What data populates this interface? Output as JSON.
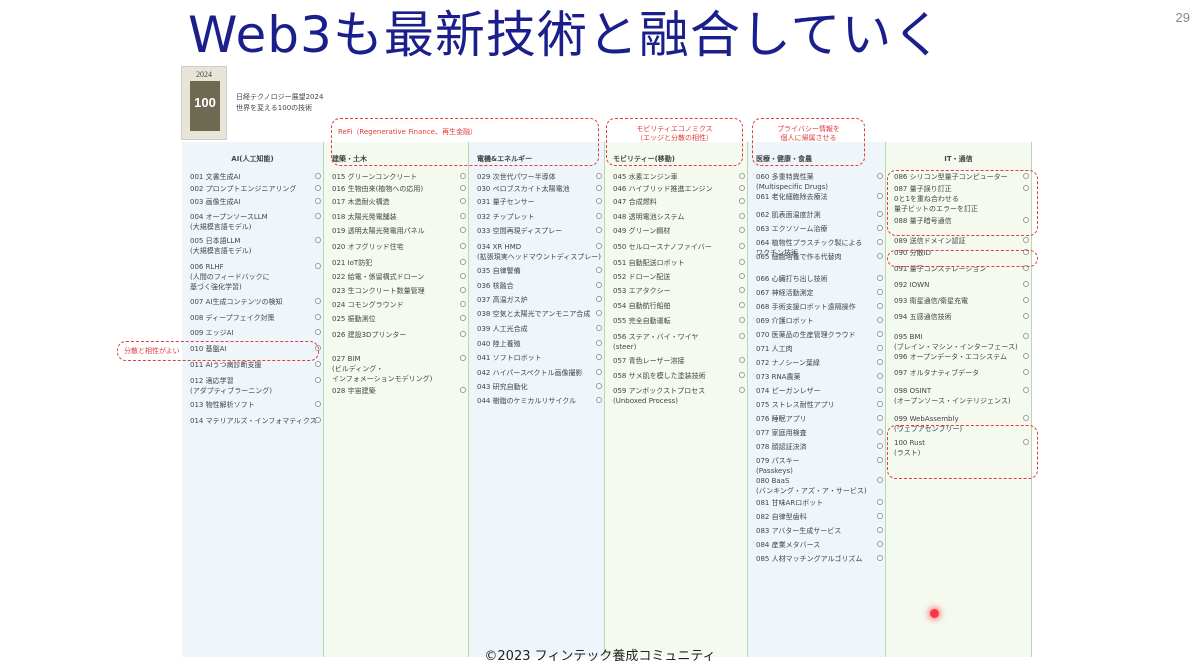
{
  "slide": {
    "title": "Web3も最新技術と融合していく",
    "page_number": "29",
    "footer": "©2023 フィンテック養成コミュニティ"
  },
  "book": {
    "cover_year": "2024",
    "cover_number": "100",
    "title_line1": "日経テクノロジー展望2024",
    "title_line2": "世界を変える100の技術"
  },
  "columns": [
    {
      "header": "AI(人工知能)",
      "items": [
        "001 文書生成AI",
        "002 プロンプトエンジニアリング",
        "003 画像生成AI",
        "004 オープンソースLLM\n(大規模言語モデル)",
        "005 日本語LLM\n(大規模言語モデル)",
        "006 RLHF\n(人間のフィードバックに\n基づく強化学習)",
        "007 AI生成コンテンツの検知",
        "008 ディープフェイク対策",
        "009 エッジAI",
        "010 基盤AI",
        "011 AIうつ病診断支援",
        "012 適応学習\n(アダプティブラーニング)",
        "013 物性解析ソフト",
        "014 マテリアルズ・インフォマティクス"
      ]
    },
    {
      "header": "建築・土木",
      "items": [
        "015 グリーンコンクリート",
        "016 生物由来(植物への応用)",
        "017 木造耐火構造",
        "018 太陽光発電舗装",
        "019 透明太陽光発電用パネル",
        "020 オフグリッド住宅",
        "021 IoT防犯",
        "022 給電・係留構式ドローン",
        "023 生コンクリート数量管理",
        "024 コモングラウンド",
        "025 振動測位",
        "026 建設3Dプリンター",
        "027 BIM\n(ビルディング・\nインフォメーションモデリング)",
        "028 宇宙建築"
      ]
    },
    {
      "header": "電機&エネルギー",
      "items": [
        "029 次世代パワー半導体",
        "030 ペロブスカイト太陽電池",
        "031 量子センサー",
        "032 チップレット",
        "033 空間再現ディスプレー",
        "034 XR HMD\n(拡張現実ヘッドマウントディスプレー)",
        "035 自律警備",
        "036 核融合",
        "037 高温ガス炉",
        "038 空気と太陽光でアンモニア合成",
        "039 人工光合成",
        "040 陸上養殖",
        "041 ソフトロボット",
        "042 ハイパースペクトル画像撮影",
        "043 研究自動化",
        "044 樹脂のケミカルリサイクル"
      ]
    },
    {
      "header": "モビリティー(移動)",
      "items": [
        "045 水素エンジン車",
        "046 ハイブリッド推進エンジン",
        "047 合成燃料",
        "048 透明電池システム",
        "049 グリーン鋼材",
        "050 セルロースナノファイバー",
        "051 自動配送ロボット",
        "052 ドローン配送",
        "053 エアタクシー",
        "054 自動航行船舶",
        "055 完全自動運転",
        "056 ステア・バイ・ワイヤ\n(steer)",
        "057 青色レーザー溶接",
        "058 サメ肌を模した塗装技術",
        "059 アンボックストプロセス\n(Unboxed Process)"
      ]
    },
    {
      "header": "医療・健康・食農",
      "items": [
        "060 多重特異性薬\n(Multispecific Drugs)",
        "061 老化細胞除去療法",
        "062 肌表面温度計測",
        "063 エクソソーム治療",
        "064 植物性プラスチック製による\nワクチン技術",
        "065 細胞培養で作る代替肉",
        "066 心臓打ち出し技術",
        "067 神経活動測定",
        "068 手術支援ロボット遠隔操作",
        "069 介護ロボット",
        "070 医薬品の生産管理クラウド",
        "071 人工肉",
        "072 ナノシーン葉緑",
        "073 RNA農薬",
        "074 ピーガンレザー",
        "075 ストレス耐性アプリ",
        "076 睡眠アプリ",
        "077 家庭用検査",
        "078 顔認証決済",
        "079 パスキー\n(Passkeys)",
        "080 BaaS\n(バンキング・アズ・ア・サービス)",
        "081 甘味ARロボット",
        "082 自律型歯科",
        "083 アバター生成サービス",
        "084 産業メタバース",
        "085 人材マッチングアルゴリズム"
      ]
    },
    {
      "header": "IT・通信",
      "items": [
        "086 シリコン型量子コンピューター",
        "087 量子誤り訂正\n0と1を重ね合わせる\n量子ビットのエラーを訂正",
        "088 量子暗号通信",
        "089 送信ドメイン認証",
        "090 分散ID",
        "091 量子コンステレーション",
        "092 IOWN",
        "093 衛星通信/衛星充電",
        "094 五感通信技術",
        "095 BMI\n(ブレイン・マシン・インターフェース)",
        "096 オープンデータ・エコシステム",
        "097 オルタナティブデータ",
        "098 OSINT\n(オープンソース・インテリジェンス)",
        "099 WebAssembly\n(ウェブアセンブリー)",
        "100 Rust\n(ラスト)"
      ]
    }
  ],
  "callouts": {
    "refi": "ReFi（Regenerative Finance、再生金融）",
    "mobility_line1": "モビリティエコノミクス",
    "mobility_line2": "（エッジと分散の相性）",
    "privacy_line1": "プライバシー情報を",
    "privacy_line2": "個人に帰属させる",
    "edge_ai": "分散と相性がよい"
  }
}
